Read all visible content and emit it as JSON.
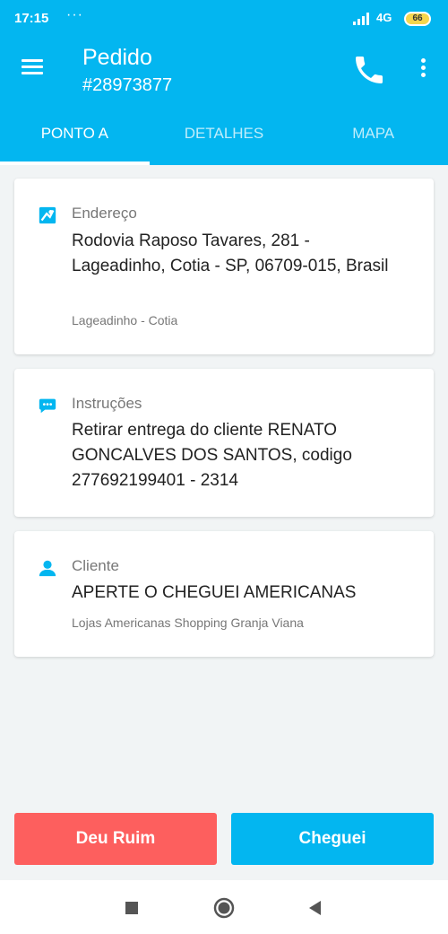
{
  "status_bar": {
    "time": "17:15",
    "dots": "···",
    "network": "4G",
    "battery": "66"
  },
  "header": {
    "title": "Pedido",
    "order_number": "#28973877",
    "menu_icon": "hamburger-menu-icon",
    "phone_icon": "phone-icon",
    "more_icon": "more-vert-icon"
  },
  "tabs": [
    {
      "label": "PONTO A",
      "active": true
    },
    {
      "label": "DETALHES",
      "active": false
    },
    {
      "label": "MAPA",
      "active": false
    }
  ],
  "address_card": {
    "label": "Endereço",
    "value": "Rodovia Raposo Tavares, 281 - Lageadinho, Cotia - SP, 06709-015, Brasil",
    "note": "Lageadinho - Cotia",
    "icon": "map-icon"
  },
  "instructions_card": {
    "label": "Instruções",
    "value": "Retirar entrega do cliente RENATO GONCALVES DOS SANTOS, codigo 277692199401 - 2314",
    "icon": "chat-icon"
  },
  "client_card": {
    "label": "Cliente",
    "value": "APERTE O CHEGUEI AMERICANAS",
    "note": "Lojas Americanas Shopping Granja Viana",
    "icon": "person-icon"
  },
  "actions": {
    "bad_label": "Deu Ruim",
    "ok_label": "Cheguei"
  },
  "colors": {
    "primary": "#03b6f0",
    "danger": "#fd5f5e",
    "background": "#f1f4f5"
  }
}
